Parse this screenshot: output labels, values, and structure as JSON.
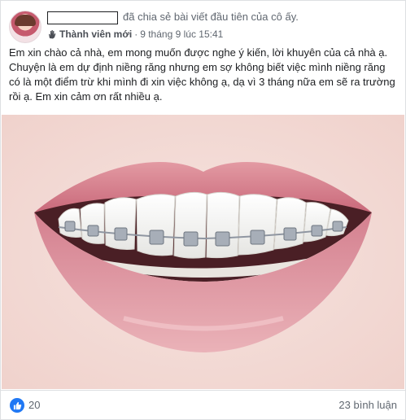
{
  "post": {
    "shared_text": "đã chia sẻ bài viết đầu tiên của cô ấy.",
    "badge": "Thành viên mới",
    "separator": "·",
    "timestamp": "9 tháng 9 lúc 15:41",
    "body": "Em xin chào cả nhà, em mong muốn được nghe ý kiến, lời khuyên của cả nhà ạ. Chuyện là em dự định niềng răng nhưng em sợ không biết việc mình niềng răng có là một điểm trừ khi mình đi xin việc không ạ, dạ vì 3 tháng nữa em sẽ ra trường rồi ạ. Em xin cảm ơn rất nhiều ạ."
  },
  "footer": {
    "like_count": "20",
    "comments": "23 bình luận"
  },
  "icons": {
    "badge": "waving-hand-icon",
    "like": "thumbs-up-icon"
  },
  "colors": {
    "like_blue": "#2078f4",
    "meta_gray": "#606770",
    "lip_pink": "#d97a86",
    "brace_metal": "#9aa1ac"
  }
}
